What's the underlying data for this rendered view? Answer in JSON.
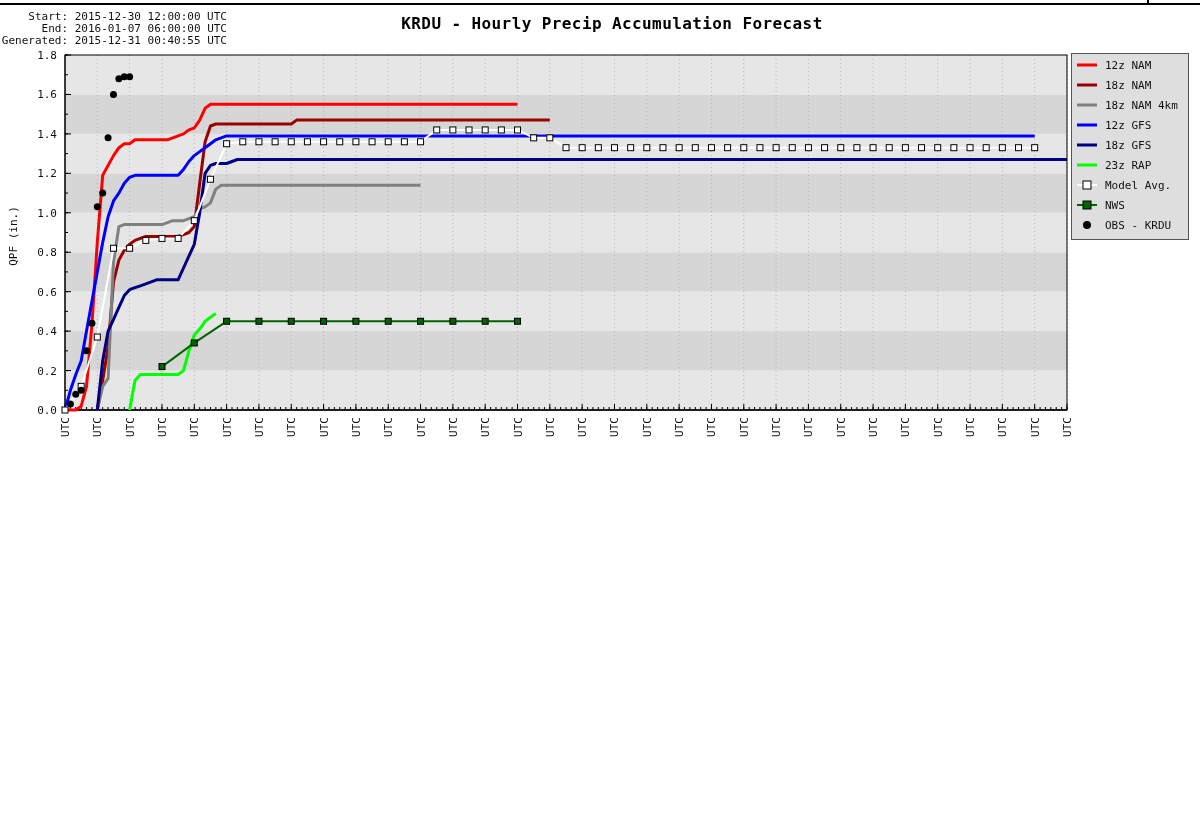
{
  "run_info": [
    "Start: 2015-12-30 12:00:00 UTC",
    "End: 2016-01-07 06:00:00 UTC",
    "Generated: 2015-12-31 00:40:55 UTC"
  ],
  "chart": {
    "chart_data": {
      "type": "line",
      "title": "KRDU - Hourly Precip Accumulation Forecast",
      "ylabel": "QPF (in.)",
      "legend": "right",
      "categories": [
        "UTC",
        null,
        null,
        null,
        null,
        null,
        "UTC",
        null,
        null,
        null,
        null,
        null,
        "UTC",
        null,
        null,
        null,
        null,
        null,
        "UTC",
        null,
        null,
        null,
        null,
        null,
        "UTC",
        null,
        null,
        null,
        null,
        null,
        "UTC",
        null,
        null,
        null,
        null,
        null,
        "UTC",
        null,
        null,
        null,
        null,
        null,
        "UTC",
        null,
        null,
        null,
        null,
        null,
        "UTC",
        null,
        null,
        null,
        null,
        null,
        "UTC",
        null,
        null,
        null,
        null,
        null,
        "UTC",
        null,
        null,
        null,
        null,
        null,
        "UTC",
        null,
        null,
        null,
        null,
        null,
        "UTC",
        null,
        null,
        null,
        null,
        null,
        "UTC",
        null,
        null,
        null,
        null,
        null,
        "UTC",
        null,
        null,
        null,
        null,
        null,
        "UTC",
        null,
        null,
        null,
        null,
        null,
        "UTC",
        null,
        null,
        null,
        null,
        null,
        "UTC",
        null,
        null,
        null,
        null,
        null,
        "UTC",
        null,
        null,
        null,
        null,
        null,
        "UTC",
        null,
        null,
        null,
        null,
        null,
        "UTC",
        null,
        null,
        null,
        null,
        null,
        "UTC",
        null,
        null,
        null,
        null,
        null,
        "UTC",
        null,
        null,
        null,
        null,
        null,
        "UTC",
        null,
        null,
        null,
        null,
        null,
        "UTC",
        null,
        null,
        null,
        null,
        null,
        "UTC",
        null,
        null,
        null,
        null,
        null,
        "UTC",
        null,
        null,
        null,
        null,
        null,
        "UTC",
        null,
        null,
        null,
        null,
        null,
        "UTC",
        null,
        null,
        null,
        null,
        null,
        "UTC",
        null,
        null,
        null,
        null,
        null,
        "UTC",
        null,
        null,
        null,
        null,
        null,
        "UTC"
      ],
      "ylim": [
        0,
        1.8
      ],
      "yticks": [
        {
          "value": 0,
          "label": "0.0"
        },
        {
          "value": 0.2,
          "label": "0.2"
        },
        {
          "value": 0.4,
          "label": "0.4"
        },
        {
          "value": 0.6,
          "label": "0.6"
        },
        {
          "value": 0.8,
          "label": "0.8"
        },
        {
          "value": 1.0,
          "label": "1.0"
        },
        {
          "value": 1.2,
          "label": "1.2"
        },
        {
          "value": 1.4,
          "label": "1.4"
        },
        {
          "value": 1.6,
          "label": "1.6"
        },
        {
          "value": 1.8,
          "label": "1.8"
        }
      ],
      "series": [
        {
          "name": "12z NAM",
          "color": "#ff0000",
          "values": [
            0,
            0,
            0,
            0.02,
            0.12,
            0.43,
            0.85,
            1.19,
            1.24,
            1.29,
            1.33,
            1.35,
            1.35,
            1.37,
            1.37,
            1.37,
            1.37,
            1.37,
            1.37,
            1.37,
            1.38,
            1.39,
            1.4,
            1.42,
            1.43,
            1.47,
            1.53,
            1.55,
            1.55,
            1.55,
            1.55,
            1.55,
            1.55,
            1.55,
            1.55,
            1.55,
            1.55,
            1.55,
            1.55,
            1.55,
            1.55,
            1.55,
            1.55,
            1.55,
            1.55,
            1.55,
            1.55,
            1.55,
            1.55,
            1.55,
            1.55,
            1.55,
            1.55,
            1.55,
            1.55,
            1.55,
            1.55,
            1.55,
            1.55,
            1.55,
            1.55,
            1.55,
            1.55,
            1.55,
            1.55,
            1.55,
            1.55,
            1.55,
            1.55,
            1.55,
            1.55,
            1.55,
            1.55,
            1.55,
            1.55,
            1.55,
            1.55,
            1.55,
            1.55,
            1.55,
            1.55,
            1.55,
            1.55,
            1.55,
            1.55,
            null,
            null,
            null,
            null,
            null,
            null,
            null,
            null,
            null,
            null,
            null,
            null,
            null,
            null,
            null,
            null,
            null,
            null,
            null,
            null,
            null,
            null,
            null,
            null,
            null,
            null,
            null,
            null,
            null,
            null,
            null,
            null,
            null,
            null,
            null,
            null,
            null,
            null,
            null,
            null,
            null,
            null,
            null,
            null,
            null,
            null,
            null,
            null,
            null,
            null,
            null,
            null,
            null,
            null,
            null,
            null,
            null,
            null,
            null,
            null,
            null,
            null,
            null,
            null,
            null,
            null,
            null,
            null,
            null,
            null,
            null,
            null,
            null,
            null,
            null,
            null,
            null,
            null,
            null,
            null,
            null,
            null,
            null,
            null,
            null,
            null,
            null,
            null,
            null,
            null,
            null,
            null,
            null,
            null,
            null,
            null,
            null,
            null,
            null,
            null,
            null,
            null
          ]
        },
        {
          "name": "18z NAM",
          "color": "#990000",
          "values": [
            null,
            null,
            null,
            null,
            null,
            null,
            0,
            0.15,
            0.32,
            0.65,
            0.76,
            0.81,
            0.84,
            0.86,
            0.87,
            0.88,
            0.88,
            0.88,
            0.88,
            0.88,
            0.88,
            0.88,
            0.89,
            0.9,
            0.93,
            1.15,
            1.36,
            1.44,
            1.45,
            1.45,
            1.45,
            1.45,
            1.45,
            1.45,
            1.45,
            1.45,
            1.45,
            1.45,
            1.45,
            1.45,
            1.45,
            1.45,
            1.45,
            1.47,
            1.47,
            1.47,
            1.47,
            1.47,
            1.47,
            1.47,
            1.47,
            1.47,
            1.47,
            1.47,
            1.47,
            1.47,
            1.47,
            1.47,
            1.47,
            1.47,
            1.47,
            1.47,
            1.47,
            1.47,
            1.47,
            1.47,
            1.47,
            1.47,
            1.47,
            1.47,
            1.47,
            1.47,
            1.47,
            1.47,
            1.47,
            1.47,
            1.47,
            1.47,
            1.47,
            1.47,
            1.47,
            1.47,
            1.47,
            1.47,
            1.47,
            1.47,
            1.47,
            1.47,
            1.47,
            1.47,
            1.47,
            null,
            null,
            null,
            null,
            null,
            null,
            null,
            null,
            null,
            null,
            null,
            null,
            null,
            null,
            null,
            null,
            null,
            null,
            null,
            null,
            null,
            null,
            null,
            null,
            null,
            null,
            null,
            null,
            null,
            null,
            null,
            null,
            null,
            null,
            null,
            null,
            null,
            null,
            null,
            null,
            null,
            null,
            null,
            null,
            null,
            null,
            null,
            null,
            null,
            null,
            null,
            null,
            null,
            null,
            null,
            null,
            null,
            null,
            null,
            null,
            null,
            null,
            null,
            null,
            null,
            null,
            null,
            null,
            null,
            null,
            null,
            null,
            null,
            null,
            null,
            null,
            null,
            null,
            null,
            null,
            null,
            null,
            null,
            null,
            null,
            null,
            null,
            null,
            null,
            null,
            null,
            null,
            null,
            null,
            null,
            null
          ]
        },
        {
          "name": "18z NAM 4km",
          "color": "#808080",
          "values": [
            null,
            null,
            null,
            null,
            null,
            null,
            0,
            0.12,
            0.16,
            0.75,
            0.93,
            0.94,
            0.94,
            0.94,
            0.94,
            0.94,
            0.94,
            0.94,
            0.94,
            0.95,
            0.96,
            0.96,
            0.96,
            0.97,
            0.98,
            1.02,
            1.03,
            1.05,
            1.12,
            1.14,
            1.14,
            1.14,
            1.14,
            1.14,
            1.14,
            1.14,
            1.14,
            1.14,
            1.14,
            1.14,
            1.14,
            1.14,
            1.14,
            1.14,
            1.14,
            1.14,
            1.14,
            1.14,
            1.14,
            1.14,
            1.14,
            1.14,
            1.14,
            1.14,
            1.14,
            1.14,
            1.14,
            1.14,
            1.14,
            1.14,
            1.14,
            1.14,
            1.14,
            1.14,
            1.14,
            1.14,
            1.14,
            null,
            null,
            null,
            null,
            null,
            null,
            null,
            null,
            null,
            null,
            null,
            null,
            null,
            null,
            null,
            null,
            null,
            null,
            null,
            null,
            null,
            null,
            null,
            null,
            null,
            null,
            null,
            null,
            null,
            null,
            null,
            null,
            null,
            null,
            null,
            null,
            null,
            null,
            null,
            null,
            null,
            null,
            null,
            null,
            null,
            null,
            null,
            null,
            null,
            null,
            null,
            null,
            null,
            null,
            null,
            null,
            null,
            null,
            null,
            null,
            null,
            null,
            null,
            null,
            null,
            null,
            null,
            null,
            null,
            null,
            null,
            null,
            null,
            null,
            null,
            null,
            null,
            null,
            null,
            null,
            null,
            null,
            null,
            null,
            null,
            null,
            null,
            null,
            null,
            null,
            null,
            null,
            null,
            null,
            null,
            null,
            null,
            null,
            null,
            null,
            null,
            null,
            null,
            null,
            null,
            null,
            null,
            null,
            null,
            null,
            null,
            null,
            null,
            null,
            null,
            null,
            null,
            null,
            null,
            null
          ]
        },
        {
          "name": "12z GFS",
          "color": "#0000ff",
          "values": [
            0,
            0.1,
            0.18,
            0.25,
            0.4,
            0.55,
            0.7,
            0.85,
            0.98,
            1.06,
            1.1,
            1.15,
            1.18,
            1.19,
            1.19,
            1.19,
            1.19,
            1.19,
            1.19,
            1.19,
            1.19,
            1.19,
            1.22,
            1.26,
            1.29,
            1.31,
            1.33,
            1.35,
            1.37,
            1.38,
            1.39,
            1.39,
            1.39,
            1.39,
            1.39,
            1.39,
            1.39,
            1.39,
            1.39,
            1.39,
            1.39,
            1.39,
            1.39,
            1.39,
            1.39,
            1.39,
            1.39,
            1.39,
            1.39,
            1.39,
            1.39,
            1.39,
            1.39,
            1.39,
            1.39,
            1.39,
            1.39,
            1.39,
            1.39,
            1.39,
            1.39,
            1.39,
            1.39,
            1.39,
            1.39,
            1.39,
            1.39,
            1.39,
            1.39,
            1.39,
            1.39,
            1.39,
            1.39,
            1.39,
            1.39,
            1.39,
            1.39,
            1.39,
            1.39,
            1.39,
            1.39,
            1.39,
            1.39,
            1.39,
            1.39,
            1.39,
            1.39,
            1.39,
            1.39,
            1.39,
            1.39,
            1.39,
            1.39,
            1.39,
            1.39,
            1.39,
            1.39,
            1.39,
            1.39,
            1.39,
            1.39,
            1.39,
            1.39,
            1.39,
            1.39,
            1.39,
            1.39,
            1.39,
            1.39,
            1.39,
            1.39,
            1.39,
            1.39,
            1.39,
            1.39,
            1.39,
            1.39,
            1.39,
            1.39,
            1.39,
            1.39,
            1.39,
            1.39,
            1.39,
            1.39,
            1.39,
            1.39,
            1.39,
            1.39,
            1.39,
            1.39,
            1.39,
            1.39,
            1.39,
            1.39,
            1.39,
            1.39,
            1.39,
            1.39,
            1.39,
            1.39,
            1.39,
            1.39,
            1.39,
            1.39,
            1.39,
            1.39,
            1.39,
            1.39,
            1.39,
            1.39,
            1.39,
            1.39,
            1.39,
            1.39,
            1.39,
            1.39,
            1.39,
            1.39,
            1.39,
            1.39,
            1.39,
            1.39,
            1.39,
            1.39,
            1.39,
            1.39,
            1.39,
            1.39,
            1.39,
            1.39,
            1.39,
            1.39,
            1.39,
            1.39,
            1.39,
            1.39,
            1.39,
            1.39,
            1.39,
            1.39,
            null,
            null,
            null,
            null,
            null,
            null
          ]
        },
        {
          "name": "18z GFS",
          "color": "#000080",
          "values": [
            null,
            null,
            null,
            null,
            null,
            null,
            0,
            0.25,
            0.4,
            0.46,
            0.52,
            0.58,
            0.61,
            0.62,
            0.63,
            0.64,
            0.65,
            0.66,
            0.66,
            0.66,
            0.66,
            0.66,
            0.72,
            0.78,
            0.84,
            1.0,
            1.2,
            1.24,
            1.25,
            1.25,
            1.25,
            1.26,
            1.27,
            1.27,
            1.27,
            1.27,
            1.27,
            1.27,
            1.27,
            1.27,
            1.27,
            1.27,
            1.27,
            1.27,
            1.27,
            1.27,
            1.27,
            1.27,
            1.27,
            1.27,
            1.27,
            1.27,
            1.27,
            1.27,
            1.27,
            1.27,
            1.27,
            1.27,
            1.27,
            1.27,
            1.27,
            1.27,
            1.27,
            1.27,
            1.27,
            1.27,
            1.27,
            1.27,
            1.27,
            1.27,
            1.27,
            1.27,
            1.27,
            1.27,
            1.27,
            1.27,
            1.27,
            1.27,
            1.27,
            1.27,
            1.27,
            1.27,
            1.27,
            1.27,
            1.27,
            1.27,
            1.27,
            1.27,
            1.27,
            1.27,
            1.27,
            1.27,
            1.27,
            1.27,
            1.27,
            1.27,
            1.27,
            1.27,
            1.27,
            1.27,
            1.27,
            1.27,
            1.27,
            1.27,
            1.27,
            1.27,
            1.27,
            1.27,
            1.27,
            1.27,
            1.27,
            1.27,
            1.27,
            1.27,
            1.27,
            1.27,
            1.27,
            1.27,
            1.27,
            1.27,
            1.27,
            1.27,
            1.27,
            1.27,
            1.27,
            1.27,
            1.27,
            1.27,
            1.27,
            1.27,
            1.27,
            1.27,
            1.27,
            1.27,
            1.27,
            1.27,
            1.27,
            1.27,
            1.27,
            1.27,
            1.27,
            1.27,
            1.27,
            1.27,
            1.27,
            1.27,
            1.27,
            1.27,
            1.27,
            1.27,
            1.27,
            1.27,
            1.27,
            1.27,
            1.27,
            1.27,
            1.27,
            1.27,
            1.27,
            1.27,
            1.27,
            1.27,
            1.27,
            1.27,
            1.27,
            1.27,
            1.27,
            1.27,
            1.27,
            1.27,
            1.27,
            1.27,
            1.27,
            1.27,
            1.27,
            1.27,
            1.27,
            1.27,
            1.27,
            1.27,
            1.27,
            1.27,
            1.27,
            1.27,
            1.27,
            1.27,
            1.27
          ]
        },
        {
          "name": "23z RAP",
          "color": "#00ff00",
          "values": [
            null,
            null,
            null,
            null,
            null,
            null,
            null,
            null,
            null,
            null,
            null,
            null,
            0,
            0.15,
            0.18,
            0.18,
            0.18,
            0.18,
            0.18,
            0.18,
            0.18,
            0.18,
            0.2,
            0.3,
            0.38,
            0.41,
            0.45,
            0.47,
            0.49,
            null,
            null,
            null,
            null,
            null,
            null,
            null,
            null,
            null,
            null,
            null,
            null,
            null,
            null,
            null,
            null,
            null,
            null,
            null,
            null,
            null,
            null,
            null,
            null,
            null,
            null,
            null,
            null,
            null,
            null,
            null,
            null,
            null,
            null,
            null,
            null,
            null,
            null,
            null,
            null,
            null,
            null,
            null,
            null,
            null,
            null,
            null,
            null,
            null,
            null,
            null,
            null,
            null,
            null,
            null,
            null,
            null,
            null,
            null,
            null,
            null,
            null,
            null,
            null,
            null,
            null,
            null,
            null,
            null,
            null,
            null,
            null,
            null,
            null,
            null,
            null,
            null,
            null,
            null,
            null,
            null,
            null,
            null,
            null,
            null,
            null,
            null,
            null,
            null,
            null,
            null,
            null,
            null,
            null,
            null,
            null,
            null,
            null,
            null,
            null,
            null,
            null,
            null,
            null,
            null,
            null,
            null,
            null,
            null,
            null,
            null,
            null,
            null,
            null,
            null,
            null,
            null,
            null,
            null,
            null,
            null,
            null,
            null,
            null,
            null,
            null,
            null,
            null,
            null,
            null,
            null,
            null,
            null,
            null,
            null,
            null,
            null,
            null,
            null,
            null,
            null,
            null,
            null,
            null,
            null,
            null,
            null,
            null,
            null,
            null,
            null,
            null,
            null,
            null,
            null,
            null,
            null,
            null
          ]
        },
        {
          "name": "Model Avg.",
          "color": "#ffffff",
          "marker": "square",
          "values": [
            0,
            null,
            null,
            0.12,
            null,
            null,
            0.37,
            null,
            null,
            0.82,
            null,
            null,
            0.82,
            null,
            null,
            0.86,
            null,
            null,
            0.87,
            null,
            null,
            0.87,
            null,
            null,
            0.96,
            null,
            null,
            1.17,
            null,
            null,
            1.35,
            null,
            null,
            1.36,
            null,
            null,
            1.36,
            null,
            null,
            1.36,
            null,
            null,
            1.36,
            null,
            null,
            1.36,
            null,
            null,
            1.36,
            null,
            null,
            1.36,
            null,
            null,
            1.36,
            null,
            null,
            1.36,
            null,
            null,
            1.36,
            null,
            null,
            1.36,
            null,
            null,
            1.36,
            null,
            null,
            1.42,
            null,
            null,
            1.42,
            null,
            null,
            1.42,
            null,
            null,
            1.42,
            null,
            null,
            1.42,
            null,
            null,
            1.42,
            null,
            null,
            1.38,
            null,
            null,
            1.38,
            null,
            null,
            1.33,
            null,
            null,
            1.33,
            null,
            null,
            1.33,
            null,
            null,
            1.33,
            null,
            null,
            1.33,
            null,
            null,
            1.33,
            null,
            null,
            1.33,
            null,
            null,
            1.33,
            null,
            null,
            1.33,
            null,
            null,
            1.33,
            null,
            null,
            1.33,
            null,
            null,
            1.33,
            null,
            null,
            1.33,
            null,
            null,
            1.33,
            null,
            null,
            1.33,
            null,
            null,
            1.33,
            null,
            null,
            1.33,
            null,
            null,
            1.33,
            null,
            null,
            1.33,
            null,
            null,
            1.33,
            null,
            null,
            1.33,
            null,
            null,
            1.33,
            null,
            null,
            1.33,
            null,
            null,
            1.33,
            null,
            null,
            1.33,
            null,
            null,
            1.33,
            null,
            null,
            1.33,
            null,
            null,
            1.33,
            null,
            null,
            1.33,
            null,
            null,
            1.33,
            null,
            null,
            null,
            null,
            null,
            null
          ]
        },
        {
          "name": "NWS",
          "color": "#006400",
          "marker": "square",
          "values": [
            null,
            null,
            null,
            null,
            null,
            null,
            null,
            null,
            null,
            null,
            null,
            null,
            null,
            null,
            null,
            null,
            null,
            null,
            0.22,
            null,
            null,
            null,
            null,
            null,
            0.34,
            null,
            null,
            null,
            null,
            null,
            0.45,
            null,
            null,
            null,
            null,
            null,
            0.45,
            null,
            null,
            null,
            null,
            null,
            0.45,
            null,
            null,
            null,
            null,
            null,
            0.45,
            null,
            null,
            null,
            null,
            null,
            0.45,
            null,
            null,
            null,
            null,
            null,
            0.45,
            null,
            null,
            null,
            null,
            null,
            0.45,
            null,
            null,
            null,
            null,
            null,
            0.45,
            null,
            null,
            null,
            null,
            null,
            0.45,
            null,
            null,
            null,
            null,
            null,
            0.45,
            null,
            null,
            null,
            null,
            null,
            null,
            null,
            null,
            null,
            null,
            null,
            null,
            null,
            null,
            null,
            null,
            null,
            null,
            null,
            null,
            null,
            null,
            null,
            null,
            null,
            null,
            null,
            null,
            null,
            null,
            null,
            null,
            null,
            null,
            null,
            null,
            null,
            null,
            null,
            null,
            null,
            null,
            null,
            null,
            null,
            null,
            null,
            null,
            null,
            null,
            null,
            null,
            null,
            null,
            null,
            null,
            null,
            null,
            null,
            null,
            null,
            null,
            null,
            null,
            null,
            null,
            null,
            null,
            null,
            null,
            null,
            null,
            null,
            null,
            null,
            null,
            null,
            null,
            null,
            null,
            null,
            null,
            null,
            null,
            null,
            null,
            null,
            null,
            null,
            null,
            null,
            null,
            null,
            null,
            null,
            null,
            null,
            null,
            null,
            null,
            null,
            null
          ]
        },
        {
          "name": "OBS - KRDU",
          "color": "#000000",
          "type": "scatter",
          "values": [
            null,
            0.03,
            0.08,
            0.1,
            0.3,
            0.44,
            1.03,
            1.1,
            1.38,
            1.6,
            1.68,
            1.69,
            1.69,
            null,
            null,
            null,
            null,
            null,
            null,
            null,
            null,
            null,
            null,
            null,
            null,
            null,
            null,
            null,
            null,
            null,
            null,
            null,
            null,
            null,
            null,
            null,
            null,
            null,
            null,
            null,
            null,
            null,
            null,
            null,
            null,
            null,
            null,
            null,
            null,
            null,
            null,
            null,
            null,
            null,
            null,
            null,
            null,
            null,
            null,
            null,
            null,
            null,
            null,
            null,
            null,
            null,
            null,
            null,
            null,
            null,
            null,
            null,
            null,
            null,
            null,
            null,
            null,
            null,
            null,
            null,
            null,
            null,
            null,
            null,
            null,
            null,
            null,
            null,
            null,
            null,
            null,
            null,
            null,
            null,
            null,
            null,
            null,
            null,
            null,
            null,
            null,
            null,
            null,
            null,
            null,
            null,
            null,
            null,
            null,
            null,
            null,
            null,
            null,
            null,
            null,
            null,
            null,
            null,
            null,
            null,
            null,
            null,
            null,
            null,
            null,
            null,
            null,
            null,
            null,
            null,
            null,
            null,
            null,
            null,
            null,
            null,
            null,
            null,
            null,
            null,
            null,
            null,
            null,
            null,
            null,
            null,
            null,
            null,
            null,
            null,
            null,
            null,
            null,
            null,
            null,
            null,
            null,
            null,
            null,
            null,
            null,
            null,
            null,
            null,
            null,
            null,
            null,
            null,
            null,
            null,
            null,
            null,
            null,
            null,
            null,
            null,
            null,
            null,
            null,
            null,
            null,
            null,
            null,
            null,
            null,
            null,
            null
          ]
        }
      ]
    }
  }
}
